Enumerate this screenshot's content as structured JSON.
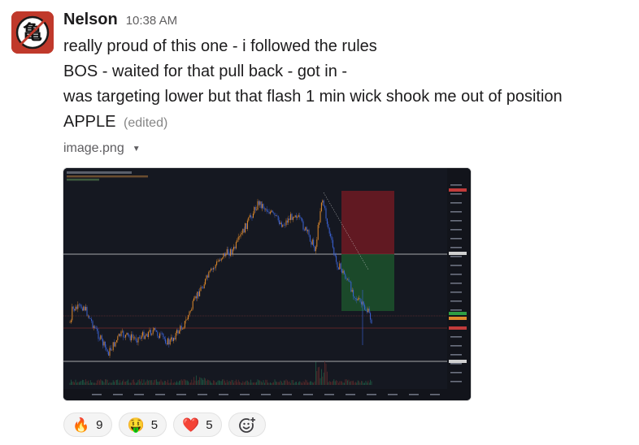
{
  "message": {
    "sender": "Nelson",
    "time": "10:38 AM",
    "lines": [
      "really proud of this one - i followed the rules",
      "BOS - waited for that pull back - got in -",
      "was targeting lower but that flash 1 min wick shook me out of position",
      "APPLE"
    ],
    "edited_label": "(edited)",
    "avatar_glyph": "亀"
  },
  "attachment": {
    "filename": "image.png",
    "caret_icon": "chevron-down-icon"
  },
  "reactions": [
    {
      "emoji": "🔥",
      "icon": "fire-icon",
      "count": "9"
    },
    {
      "emoji": "🤑",
      "icon": "money-mouth-face-icon",
      "count": "5"
    },
    {
      "emoji": "❤️",
      "icon": "red-heart-icon",
      "count": "5"
    }
  ],
  "add_reaction_icon": "add-reaction-icon",
  "colors": {
    "chart_bg": "#151821",
    "candle_up": "#e38c2c",
    "candle_down": "#3b63d8",
    "stop_zone": "#6e1a22",
    "target_zone": "#1c4f2b",
    "avatar_bg": "#c0392b"
  }
}
